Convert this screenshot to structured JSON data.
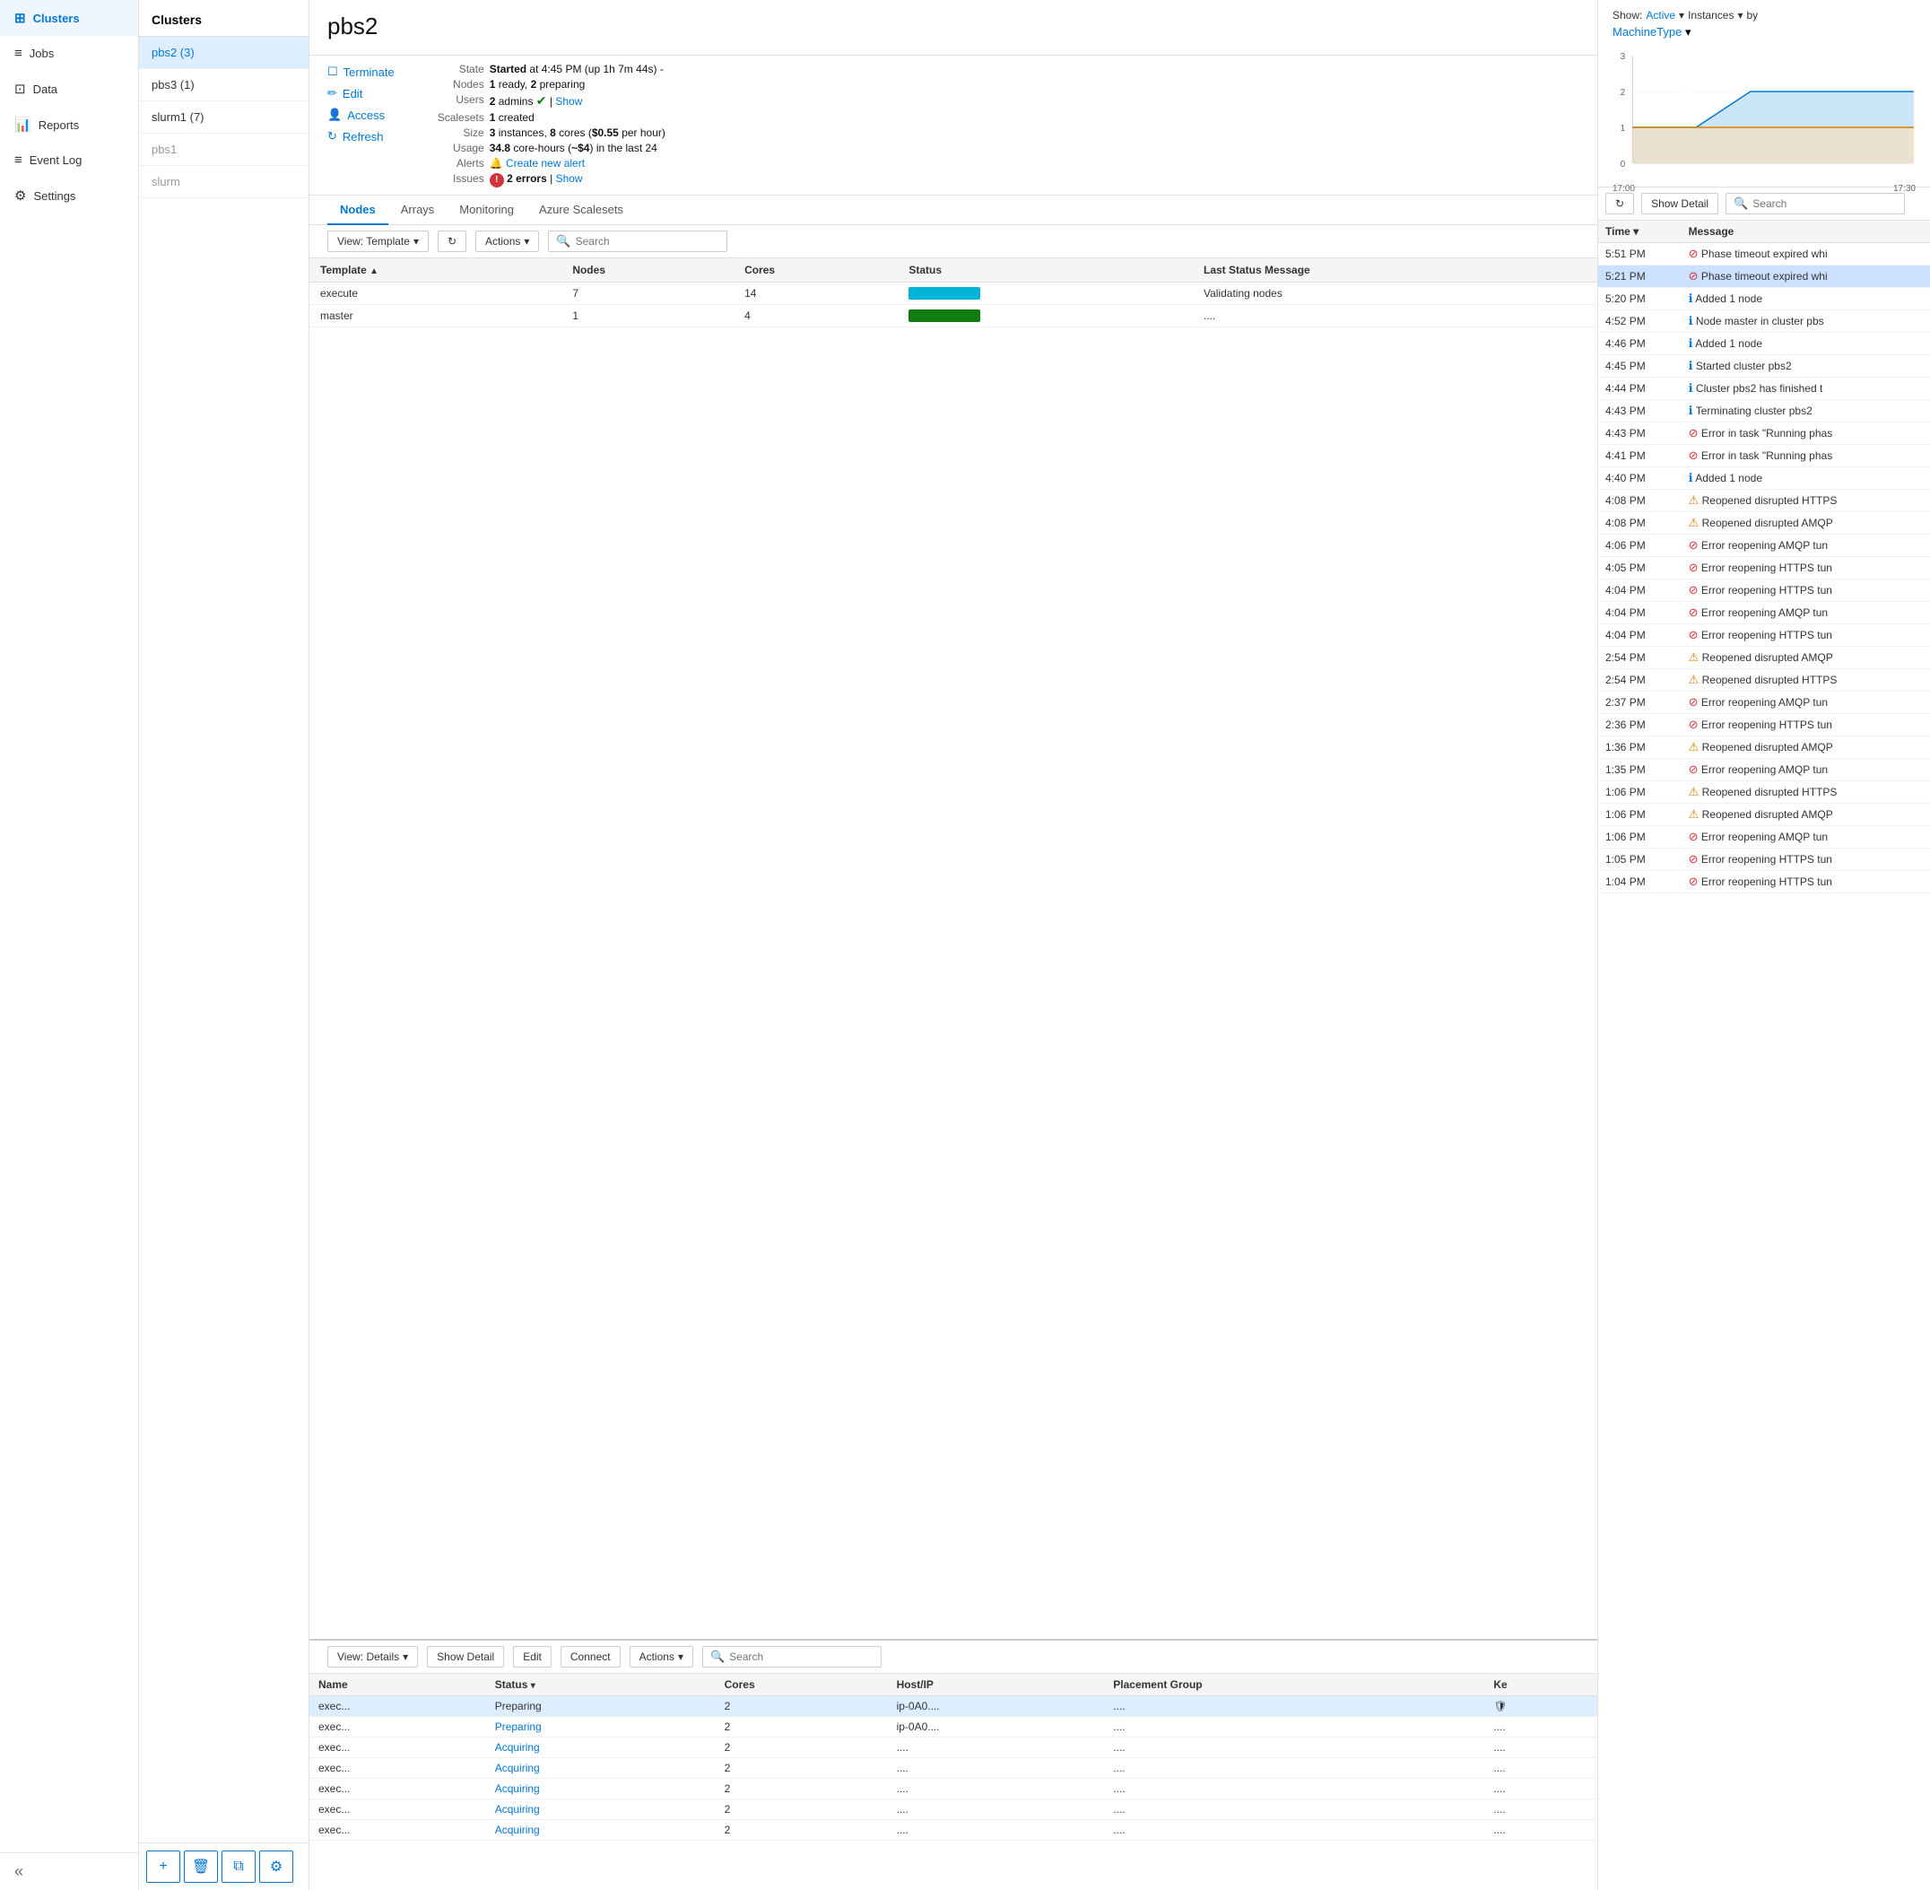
{
  "nav": {
    "items": [
      {
        "id": "clusters",
        "label": "Clusters",
        "icon": "⊞",
        "active": true
      },
      {
        "id": "jobs",
        "label": "Jobs",
        "icon": "≡"
      },
      {
        "id": "data",
        "label": "Data",
        "icon": "⊡"
      },
      {
        "id": "reports",
        "label": "Reports",
        "icon": "📊"
      },
      {
        "id": "eventlog",
        "label": "Event Log",
        "icon": "≡"
      },
      {
        "id": "settings",
        "label": "Settings",
        "icon": "⚙"
      }
    ],
    "collapse_icon": "«"
  },
  "cluster_list": {
    "header": "Clusters",
    "items": [
      {
        "name": "pbs2 (3)",
        "active": true
      },
      {
        "name": "pbs3 (1)",
        "active": false
      },
      {
        "name": "slurm1 (7)",
        "active": false
      },
      {
        "name": "pbs1",
        "active": false,
        "dimmed": true
      },
      {
        "name": "slurm",
        "active": false,
        "dimmed": true
      }
    ],
    "footer_buttons": [
      "+",
      "🗑",
      "⧉",
      "⚙"
    ]
  },
  "cluster_detail": {
    "title": "pbs2",
    "state_label": "State",
    "state_value": "Started at 4:45 PM (up 1h 7m 44s) -",
    "nodes_label": "Nodes",
    "nodes_value": "1 ready, 2 preparing",
    "users_label": "Users",
    "users_value": "2 admins",
    "users_show": "Show",
    "scalesets_label": "Scalesets",
    "scalesets_value": "1 created",
    "size_label": "Size",
    "size_value": "3 instances, 8 cores ($0.55 per hour)",
    "usage_label": "Usage",
    "usage_value": "34.8 core-hours (~$4) in the last 24",
    "alerts_label": "Alerts",
    "alerts_create": "Create new alert",
    "issues_label": "Issues",
    "issues_count": "2 errors",
    "issues_show": "Show",
    "actions": [
      {
        "id": "terminate",
        "label": "Terminate",
        "icon": "☐"
      },
      {
        "id": "edit",
        "label": "Edit",
        "icon": "✏"
      },
      {
        "id": "access",
        "label": "Access",
        "icon": "👤"
      },
      {
        "id": "refresh",
        "label": "Refresh",
        "icon": "↻"
      }
    ]
  },
  "tabs": {
    "items": [
      {
        "id": "nodes",
        "label": "Nodes",
        "active": true
      },
      {
        "id": "arrays",
        "label": "Arrays"
      },
      {
        "id": "monitoring",
        "label": "Monitoring"
      },
      {
        "id": "azure_scalesets",
        "label": "Azure Scalesets"
      }
    ]
  },
  "nodes_toolbar": {
    "view_label": "View: Template",
    "refresh_icon": "↻",
    "actions_label": "Actions",
    "search_placeholder": "Search"
  },
  "nodes_table": {
    "columns": [
      "Template",
      "Nodes",
      "Cores",
      "Status",
      "Last Status Message"
    ],
    "rows": [
      {
        "template": "execute",
        "nodes": "7",
        "cores": "14",
        "status": "teal",
        "message": "Validating nodes"
      },
      {
        "template": "master",
        "nodes": "1",
        "cores": "4",
        "status": "green",
        "message": "...."
      }
    ]
  },
  "bottom_panel": {
    "view_label": "View: Details",
    "show_detail": "Show Detail",
    "edit": "Edit",
    "connect": "Connect",
    "actions_label": "Actions",
    "search_placeholder": "Search",
    "columns": [
      "Name",
      "Status",
      "Cores",
      "Host/IP",
      "Placement Group",
      "Ke"
    ],
    "rows": [
      {
        "name": "exec...",
        "status": "Preparing",
        "status_type": "normal",
        "cores": "2",
        "host": "ip-0A0...",
        "placement": "....",
        "ke": "🛡"
      },
      {
        "name": "exec...",
        "status": "Preparing",
        "status_type": "link",
        "cores": "2",
        "host": "ip-0A0...",
        "placement": "....",
        "ke": "...."
      },
      {
        "name": "exec...",
        "status": "Acquiring",
        "status_type": "link",
        "cores": "2",
        "host": "....",
        "placement": "....",
        "ke": "...."
      },
      {
        "name": "exec...",
        "status": "Acquiring",
        "status_type": "link",
        "cores": "2",
        "host": "....",
        "placement": "....",
        "ke": "...."
      },
      {
        "name": "exec...",
        "status": "Acquiring",
        "status_type": "link",
        "cores": "2",
        "host": "....",
        "placement": "....",
        "ke": "...."
      },
      {
        "name": "exec...",
        "status": "Acquiring",
        "status_type": "link",
        "cores": "2",
        "host": "....",
        "placement": "....",
        "ke": "...."
      },
      {
        "name": "exec...",
        "status": "Acquiring",
        "status_type": "link",
        "cores": "2",
        "host": "....",
        "placement": "....",
        "ke": "...."
      }
    ]
  },
  "chart": {
    "show_label": "Show:",
    "active_label": "Active",
    "instances_label": "Instances",
    "by_label": "by",
    "machine_type_label": "MachineType",
    "y_labels": [
      "3",
      "2",
      "1",
      "0"
    ],
    "x_labels": [
      "17:00",
      "17:30"
    ],
    "colors": {
      "blue_area": "#b3d9f5",
      "blue_line": "#0078d4",
      "orange_area": "#ffe0b2",
      "orange_line": "#d68000"
    }
  },
  "log": {
    "refresh_icon": "↻",
    "show_detail": "Show Detail",
    "search_placeholder": "Search",
    "columns": [
      "Time",
      "Message"
    ],
    "rows": [
      {
        "time": "5:51 PM",
        "type": "error",
        "msg": "Phase timeout expired whi"
      },
      {
        "time": "5:21 PM",
        "type": "error",
        "msg": "Phase timeout expired whi",
        "selected": true
      },
      {
        "time": "5:20 PM",
        "type": "info",
        "msg": "Added 1 node"
      },
      {
        "time": "4:52 PM",
        "type": "info",
        "msg": "Node master in cluster pbs"
      },
      {
        "time": "4:46 PM",
        "type": "info",
        "msg": "Added 1 node"
      },
      {
        "time": "4:45 PM",
        "type": "info",
        "msg": "Started cluster pbs2"
      },
      {
        "time": "4:44 PM",
        "type": "info",
        "msg": "Cluster pbs2 has finished t"
      },
      {
        "time": "4:43 PM",
        "type": "info",
        "msg": "Terminating cluster pbs2"
      },
      {
        "time": "4:43 PM",
        "type": "error",
        "msg": "Error in task \"Running phas"
      },
      {
        "time": "4:41 PM",
        "type": "error",
        "msg": "Error in task \"Running phas"
      },
      {
        "time": "4:40 PM",
        "type": "info",
        "msg": "Added 1 node"
      },
      {
        "time": "4:08 PM",
        "type": "warn",
        "msg": "Reopened disrupted HTTPS"
      },
      {
        "time": "4:08 PM",
        "type": "warn",
        "msg": "Reopened disrupted AMQP"
      },
      {
        "time": "4:06 PM",
        "type": "error",
        "msg": "Error reopening AMQP tun"
      },
      {
        "time": "4:05 PM",
        "type": "error",
        "msg": "Error reopening HTTPS tun"
      },
      {
        "time": "4:04 PM",
        "type": "error",
        "msg": "Error reopening HTTPS tun"
      },
      {
        "time": "4:04 PM",
        "type": "error",
        "msg": "Error reopening AMQP tun"
      },
      {
        "time": "4:04 PM",
        "type": "error",
        "msg": "Error reopening HTTPS tun"
      },
      {
        "time": "2:54 PM",
        "type": "warn",
        "msg": "Reopened disrupted AMQP"
      },
      {
        "time": "2:54 PM",
        "type": "warn",
        "msg": "Reopened disrupted HTTPS"
      },
      {
        "time": "2:37 PM",
        "type": "error",
        "msg": "Error reopening AMQP tun"
      },
      {
        "time": "2:36 PM",
        "type": "error",
        "msg": "Error reopening HTTPS tun"
      },
      {
        "time": "1:36 PM",
        "type": "warn",
        "msg": "Reopened disrupted AMQP"
      },
      {
        "time": "1:35 PM",
        "type": "error",
        "msg": "Error reopening AMQP tun"
      },
      {
        "time": "1:06 PM",
        "type": "warn",
        "msg": "Reopened disrupted HTTPS"
      },
      {
        "time": "1:06 PM",
        "type": "warn",
        "msg": "Reopened disrupted AMQP"
      },
      {
        "time": "1:06 PM",
        "type": "error",
        "msg": "Error reopening AMQP tun"
      },
      {
        "time": "1:05 PM",
        "type": "error",
        "msg": "Error reopening HTTPS tun"
      },
      {
        "time": "1:04 PM",
        "type": "error",
        "msg": "Error reopening HTTPS tun"
      }
    ]
  }
}
